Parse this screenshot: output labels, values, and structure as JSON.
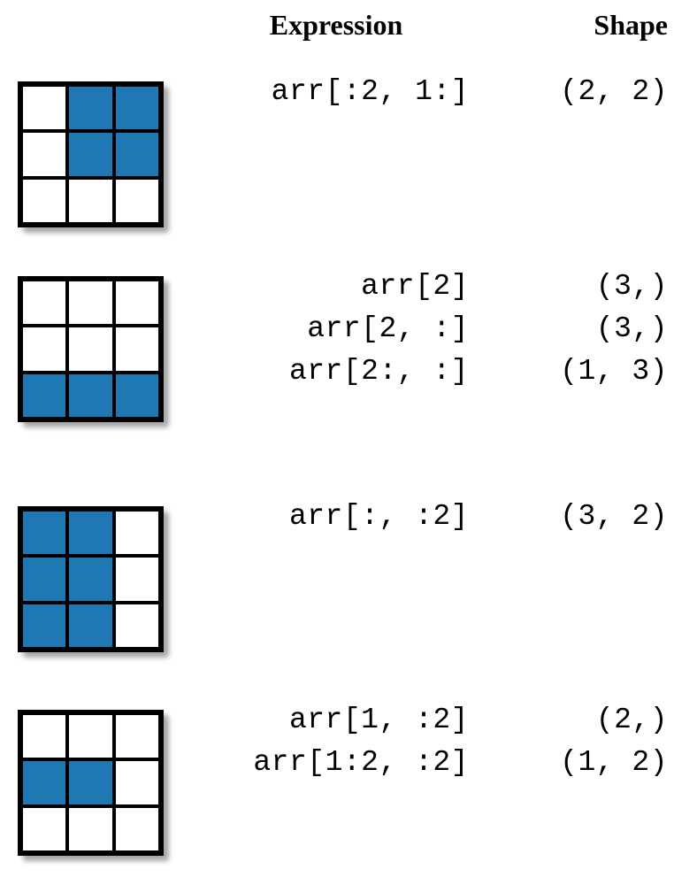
{
  "headers": {
    "expression": "Expression",
    "shape": "Shape"
  },
  "rows": [
    {
      "fills": [
        0,
        1,
        1,
        0,
        1,
        1,
        0,
        0,
        0
      ],
      "expressions": [
        "arr[:2, 1:]"
      ],
      "shapes": [
        "(2, 2)"
      ]
    },
    {
      "fills": [
        0,
        0,
        0,
        0,
        0,
        0,
        1,
        1,
        1
      ],
      "expressions": [
        "arr[2]",
        "arr[2, :]",
        "arr[2:, :]"
      ],
      "shapes": [
        "(3,)",
        "(3,)",
        "(1, 3)"
      ]
    },
    {
      "fills": [
        1,
        1,
        0,
        1,
        1,
        0,
        1,
        1,
        0
      ],
      "expressions": [
        "arr[:, :2]"
      ],
      "shapes": [
        "(3, 2)"
      ]
    },
    {
      "fills": [
        0,
        0,
        0,
        1,
        1,
        0,
        0,
        0,
        0
      ],
      "expressions": [
        "arr[1, :2]",
        "arr[1:2, :2]"
      ],
      "shapes": [
        "(2,)",
        "(1, 2)"
      ]
    }
  ]
}
